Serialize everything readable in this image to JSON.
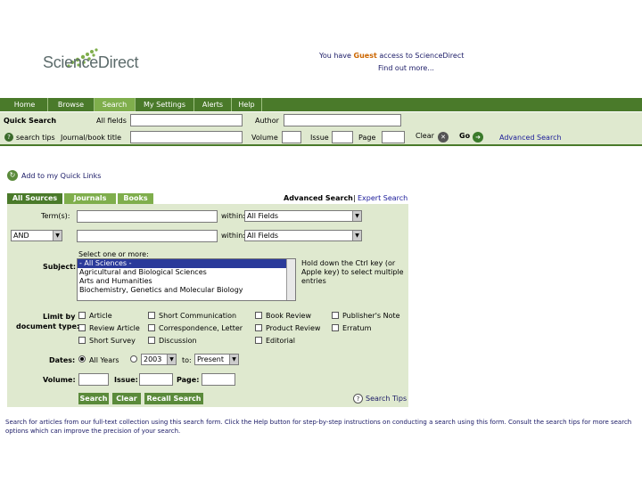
{
  "brand": {
    "logo_text": "ScienceDirect"
  },
  "header": {
    "access_prefix": "You have ",
    "access_guest": "Guest",
    "access_suffix": " access to ScienceDirect",
    "find_out": "Find out more..."
  },
  "nav": {
    "tabs": [
      "Home",
      "Browse",
      "Search",
      "My Settings",
      "Alerts",
      "Help"
    ],
    "active": "Search"
  },
  "quick_search": {
    "title": "Quick Search",
    "all_fields_label": "All fields",
    "author_label": "Author",
    "search_tips_label": "search tips",
    "journal_label": "Journal/book title",
    "volume_label": "Volume",
    "issue_label": "Issue",
    "page_label": "Page",
    "clear_label": "Clear",
    "go_label": "Go",
    "advanced_link": "Advanced Search"
  },
  "quick_links": {
    "label": "Add to my Quick Links"
  },
  "source_tabs": [
    "All Sources",
    "Journals",
    "Books"
  ],
  "search_modes": {
    "advanced": "Advanced Search",
    "separator": "|",
    "expert": "Expert Search"
  },
  "form": {
    "terms_label": "Term(s):",
    "within_label": "within:",
    "within_value_1": "All Fields",
    "within_value_2": "All Fields",
    "bool_value": "AND",
    "select_hint": "Select one or more:",
    "subject_label": "Subject:",
    "subjects": [
      "- All Sciences -",
      "Agricultural and Biological Sciences",
      "Arts and Humanities",
      "Biochemistry, Genetics and Molecular Biology"
    ],
    "ctrl_hint": "Hold down the Ctrl key (or Apple key) to select multiple entries",
    "limit_label_1": "Limit by",
    "limit_label_2": "document type:",
    "doc_types": [
      "Article",
      "Short Communication",
      "Book Review",
      "Publisher's Note",
      "Review Article",
      "Correspondence, Letter",
      "Product Review",
      "Erratum",
      "Short Survey",
      "Discussion",
      "Editorial"
    ],
    "dates_label": "Dates:",
    "all_years": "All Years",
    "year_from": "2003",
    "to_label": "to:",
    "year_to": "Present",
    "volume_label": "Volume:",
    "issue_label": "Issue:",
    "page_label": "Page:",
    "buttons": [
      "Search",
      "Clear",
      "Recall Search"
    ],
    "search_tips": "Search Tips"
  },
  "footer": {
    "text": "Search for articles from our full-text collection using this search form. Click the Help button for step-by-step instructions on conducting a search using this form. Consult the search tips for more search options which can improve the precision of your search."
  },
  "colors": {
    "nav": "#4a7a2a",
    "nav_active": "#7fae4c",
    "panel": "#dfe9cf",
    "accent": "#cc6600",
    "link": "#1a1a66"
  }
}
